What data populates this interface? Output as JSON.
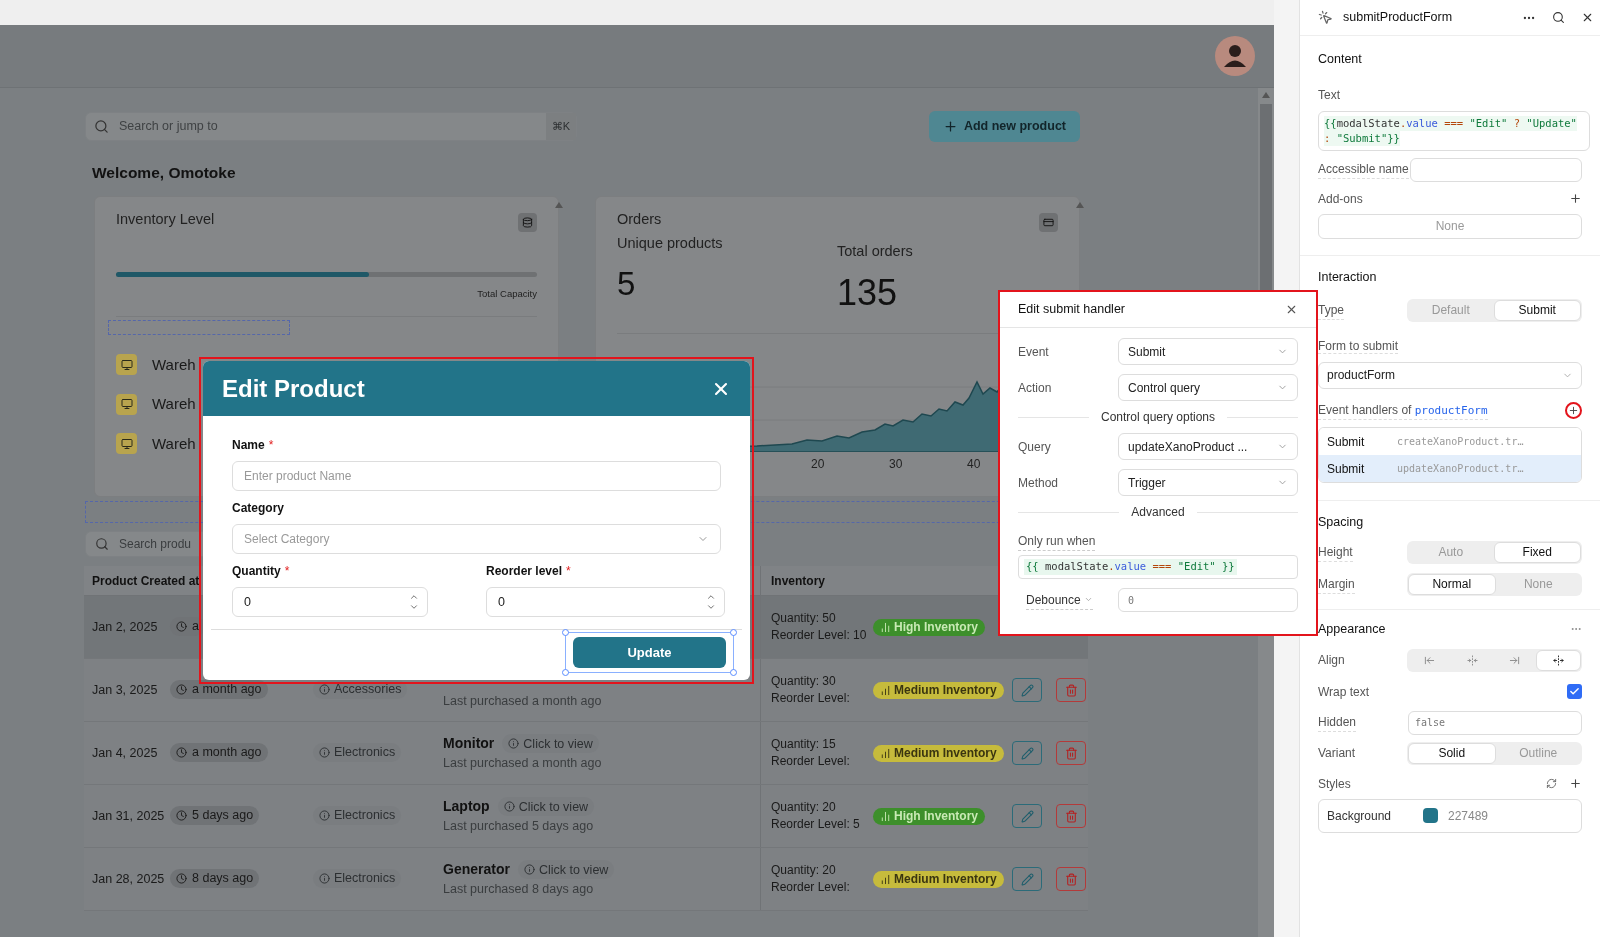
{
  "canvas": {
    "search": {
      "placeholder": "Search or jump to",
      "shortcut": "⌘K"
    },
    "add_button": "Add new product",
    "welcome": "Welcome, Omotoke",
    "inventory_card": {
      "title": "Inventory Level",
      "level": 0.6,
      "capacity_label": "Total Capacity",
      "warehouses": [
        "Wareh",
        "Wareh",
        "Wareh"
      ]
    },
    "orders_card": {
      "title": "Orders",
      "stats": [
        {
          "label": "Unique products",
          "value": "5"
        },
        {
          "label": "Total orders",
          "value": "135"
        }
      ],
      "chart_ticks": [
        "20",
        "30",
        "40"
      ]
    },
    "table": {
      "search_placeholder": "Search produ",
      "columns": [
        "Product Created at",
        "Inventory"
      ],
      "rows": [
        {
          "date": "Jan 2, 2025",
          "age": "a",
          "quantity": "Quantity: 50",
          "reorder": "Reorder Level: 10",
          "badge": {
            "label": "High Inventory",
            "kind": "high",
            "color": "#3d8f2b"
          },
          "selected": true
        },
        {
          "date": "Jan 3, 2025",
          "age": "a month ago",
          "category": "Accessories",
          "purchased": "Last purchased a month ago",
          "quantity": "Quantity: 30",
          "reorder": "Reorder Level:",
          "badge": {
            "label": "Medium Inventory",
            "kind": "medium",
            "color": "#c6bb3c"
          },
          "actions": true,
          "selected": false
        },
        {
          "date": "Jan 4, 2025",
          "age": "a month ago",
          "category": "Electronics",
          "product": "Monitor",
          "view": "Click to view",
          "purchased": "Last purchased a month ago",
          "quantity": "Quantity: 15",
          "reorder": "Reorder Level:",
          "badge": {
            "label": "Medium Inventory",
            "kind": "medium",
            "color": "#c6bb3c"
          },
          "actions": true,
          "selected": false
        },
        {
          "date": "Jan 31, 2025",
          "age": "5 days ago",
          "category": "Electronics",
          "product": "Laptop",
          "view": "Click to view",
          "purchased": "Last purchased 5 days ago",
          "quantity": "Quantity: 20",
          "reorder": "Reorder Level: 5",
          "badge": {
            "label": "High Inventory",
            "kind": "high",
            "color": "#3d8f2b"
          },
          "actions": true,
          "selected": false
        },
        {
          "date": "Jan 28, 2025",
          "age": "8 days ago",
          "category": "Electronics",
          "product": "Generator",
          "view": "Click to view",
          "purchased": "Last purchased 8 days ago",
          "quantity": "Quantity: 20",
          "reorder": "Reorder Level:",
          "badge": {
            "label": "Medium Inventory",
            "kind": "medium",
            "color": "#c6bb3c"
          },
          "actions": true,
          "selected": false
        }
      ]
    }
  },
  "modal": {
    "title": "Edit Product",
    "required_mark": "*",
    "fields": [
      {
        "label": "Name",
        "required": true,
        "kind": "text",
        "placeholder": "Enter product Name"
      },
      {
        "label": "Category",
        "required": false,
        "kind": "select",
        "placeholder": "Select Category"
      },
      {
        "label": "Quantity",
        "required": true,
        "kind": "number",
        "value": "0"
      },
      {
        "label": "Reorder level",
        "required": true,
        "kind": "number",
        "value": "0"
      }
    ],
    "submit": "Update",
    "submit_selected": true
  },
  "handler_popup": {
    "title": "Edit submit handler",
    "items": [
      {
        "kind": "select",
        "label": "Event",
        "value": "Submit"
      },
      {
        "kind": "select",
        "label": "Action",
        "value": "Control query"
      },
      {
        "kind": "heading",
        "label": "Control query options"
      },
      {
        "kind": "select",
        "label": "Query",
        "value": "updateXanoProduct ..."
      },
      {
        "kind": "select",
        "label": "Method",
        "value": "Trigger"
      },
      {
        "kind": "heading",
        "label": "Advanced"
      },
      {
        "kind": "code",
        "label": "Only run when",
        "value": "{{ modalState.value === \"Edit\" }}"
      },
      {
        "kind": "debounce",
        "label": "Debounce",
        "value": "0"
      }
    ]
  },
  "inspector": {
    "title": "submitProductForm",
    "content": {
      "heading": "Content",
      "text_label": "Text",
      "text_code_lines": [
        "{{modalState.value === \"Edit\" ? \"Update\"",
        ": \"Submit\"}}"
      ],
      "accessible_label": "Accessible name",
      "addons_label": "Add-ons",
      "addons_value": "None"
    },
    "interaction": {
      "heading": "Interaction",
      "type_label": "Type",
      "type_options": [
        {
          "label": "Default",
          "selected": false
        },
        {
          "label": "Submit",
          "selected": true
        }
      ],
      "form_label": "Form to submit",
      "form_value": "productForm",
      "handlers_label": "Event handlers of",
      "handlers_form": "productForm",
      "handlers": [
        {
          "event": "Submit",
          "action": "createXanoProduct.tr…",
          "selected": false
        },
        {
          "event": "Submit",
          "action": "updateXanoProduct.tr…",
          "selected": true
        }
      ]
    },
    "spacing": {
      "heading": "Spacing",
      "rows": [
        {
          "label": "Height",
          "options": [
            {
              "label": "Auto",
              "selected": false
            },
            {
              "label": "Fixed",
              "selected": true
            }
          ]
        },
        {
          "label": "Margin",
          "options": [
            {
              "label": "Normal",
              "selected": true
            },
            {
              "label": "None",
              "selected": false
            }
          ]
        }
      ]
    },
    "appearance": {
      "heading": "Appearance",
      "align_label": "Align",
      "align_options": [
        {
          "kind": "left",
          "selected": false
        },
        {
          "kind": "center",
          "selected": false
        },
        {
          "kind": "right",
          "selected": false
        },
        {
          "kind": "stretch",
          "selected": true
        }
      ],
      "wrap_label": "Wrap text",
      "wrap_checked": true,
      "hidden_label": "Hidden",
      "hidden_value": "false",
      "variant_label": "Variant",
      "variant_options": [
        {
          "label": "Solid",
          "selected": true
        },
        {
          "label": "Outline",
          "selected": false
        }
      ],
      "styles_label": "Styles",
      "styles": [
        {
          "label": "Background",
          "color": "#227489",
          "value": "227489"
        }
      ]
    }
  }
}
